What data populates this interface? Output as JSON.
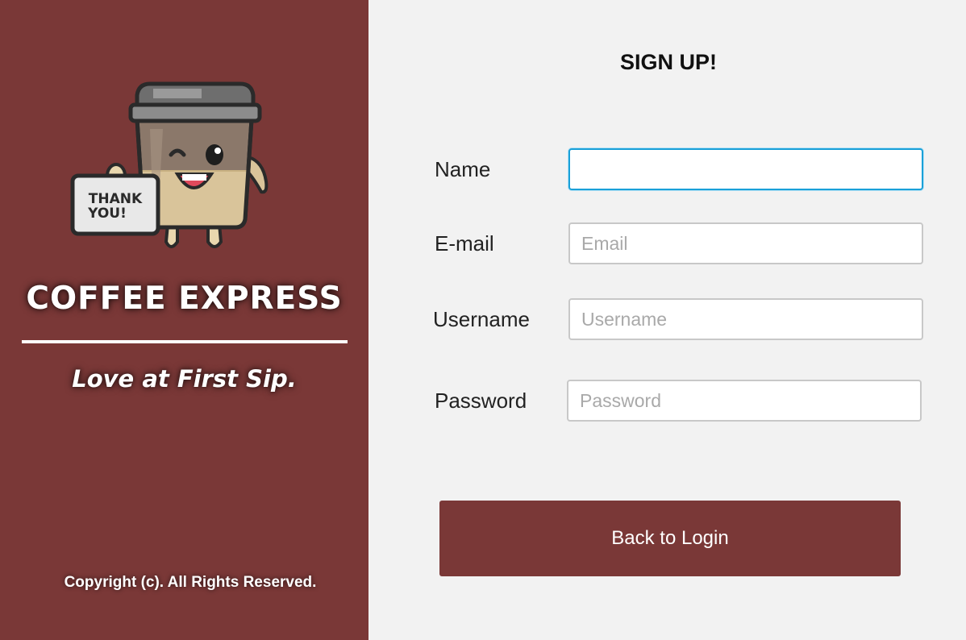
{
  "brand": {
    "title": "COFFEE EXPRESS",
    "tagline": "Love at First Sip.",
    "copyright": "Copyright (c). All Rights Reserved.",
    "mascot_sign": [
      "THANK",
      "YOU!"
    ],
    "panel_color": "#7a3837"
  },
  "form": {
    "heading": "SIGN UP!",
    "fields": {
      "name": {
        "label": "Name",
        "value": "",
        "placeholder": ""
      },
      "email": {
        "label": "E-mail",
        "value": "",
        "placeholder": "Email"
      },
      "username": {
        "label": "Username",
        "value": "",
        "placeholder": "Username"
      },
      "password": {
        "label": "Password",
        "value": "",
        "placeholder": "Password"
      }
    },
    "focused_field": "name",
    "focus_color": "#1aa0d8"
  },
  "actions": {
    "back_label": "Back to Login",
    "button_color": "#7a3837"
  }
}
